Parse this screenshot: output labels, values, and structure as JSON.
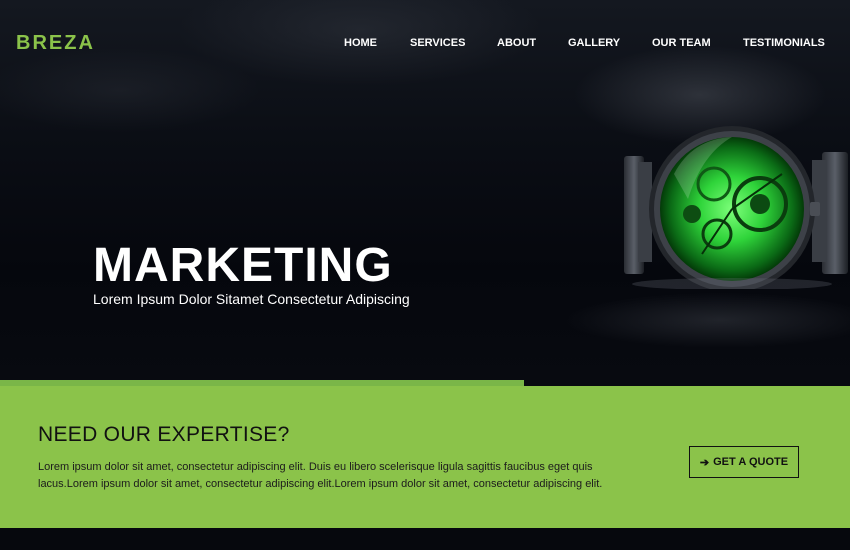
{
  "brand": {
    "logo": "BREZA",
    "accent_color": "#8bc34a"
  },
  "nav": {
    "items": [
      {
        "label": "HOME"
      },
      {
        "label": "SERVICES"
      },
      {
        "label": "ABOUT"
      },
      {
        "label": "GALLERY"
      },
      {
        "label": "OUR TEAM"
      },
      {
        "label": "TESTIMONIALS"
      }
    ]
  },
  "hero": {
    "title": "MARKETING",
    "subtitle": "Lorem Ipsum Dolor Sitamet Consectetur Adipiscing"
  },
  "cta": {
    "heading": "NEED OUR EXPERTISE?",
    "text": "Lorem ipsum dolor sit amet, consectetur adipiscing elit. Duis eu libero scelerisque ligula sagittis faucibus eget quis lacus.Lorem ipsum dolor sit amet, consectetur adipiscing elit.Lorem ipsum dolor sit amet, consectetur adipiscing elit.",
    "button_label": "GET A QUOTE",
    "button_icon": "arrow-right-icon",
    "background_color": "#8bc34a"
  }
}
